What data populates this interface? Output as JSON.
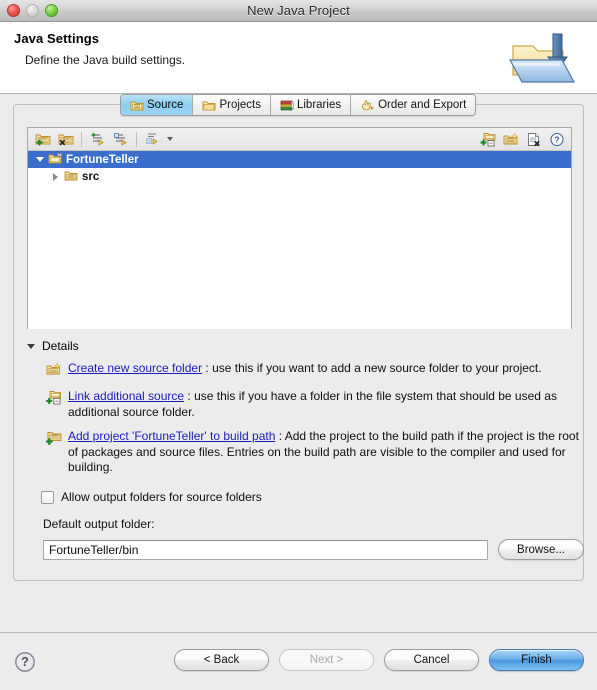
{
  "window": {
    "title": "New Java Project",
    "controls": {
      "close": "close-button",
      "minimize": "minimize-button",
      "zoom": "zoom-button"
    }
  },
  "header": {
    "title": "Java Settings",
    "subtitle": "Define the Java build settings.",
    "icon": "java-project-folder-icon"
  },
  "tabs": [
    {
      "label": "Source",
      "icon": "source-folder-icon",
      "active": true
    },
    {
      "label": "Projects",
      "icon": "projects-folder-icon",
      "active": false
    },
    {
      "label": "Libraries",
      "icon": "libraries-books-icon",
      "active": false
    },
    {
      "label": "Order and Export",
      "icon": "order-export-hand-icon",
      "active": false
    }
  ],
  "tree_toolbar": {
    "left": [
      {
        "name": "add-source-folder-icon",
        "tooltip": "Add Folder"
      },
      {
        "name": "remove-source-folder-icon",
        "tooltip": "Remove Folder"
      },
      {
        "name": "add-inclusion-filter-icon",
        "tooltip": "Add Inclusion"
      },
      {
        "name": "add-exclusion-filter-icon",
        "tooltip": "Add Exclusion"
      },
      {
        "name": "configure-filters-icon",
        "tooltip": "Configure"
      }
    ],
    "right": [
      {
        "name": "link-source-icon",
        "tooltip": "Link Source"
      },
      {
        "name": "create-folder-icon",
        "tooltip": "Create New Folder"
      },
      {
        "name": "remove-entry-icon",
        "tooltip": "Remove"
      },
      {
        "name": "help-circle-icon",
        "tooltip": "Help"
      }
    ]
  },
  "tree": [
    {
      "label": "FortuneTeller",
      "icon": "java-project-icon",
      "selected": true,
      "expanded": true,
      "depth": 0
    },
    {
      "label": "src",
      "icon": "source-folder-icon",
      "selected": false,
      "expanded": false,
      "depth": 1
    }
  ],
  "details": {
    "header": "Details",
    "expanded": true,
    "items": [
      {
        "icon": "create-source-folder-icon",
        "link": "Create new source folder",
        "text": " : use this if you want to add a new source folder to your project."
      },
      {
        "icon": "link-additional-source-icon",
        "link": "Link additional source",
        "text": " : use this if you have a folder in the file system that should be used as additional source folder."
      },
      {
        "icon": "add-project-to-build-path-icon",
        "link": "Add project 'FortuneTeller' to build path",
        "text": " : Add the project to the build path if the project is the root of packages and source files. Entries on the build path are visible to the compiler and used for building."
      }
    ]
  },
  "allow_output_folders": {
    "label": "Allow output folders for source folders",
    "checked": false
  },
  "default_output_folder": {
    "label": "Default output folder:",
    "value": "FortuneTeller/bin",
    "placeholder": "",
    "browse_label": "Browse..."
  },
  "footer": {
    "help_icon": "help-circle-icon",
    "buttons": [
      {
        "label": "< Back",
        "state": "enabled",
        "name": "back-button"
      },
      {
        "label": "Next >",
        "state": "disabled",
        "name": "next-button"
      },
      {
        "label": "Cancel",
        "state": "enabled",
        "name": "cancel-button"
      },
      {
        "label": "Finish",
        "state": "default",
        "name": "finish-button"
      }
    ]
  },
  "colors": {
    "selection_blue": "#3b6ecc",
    "active_tab_blue": "#8ecdf0",
    "link_blue": "#1b1bbb",
    "window_bg": "#ececec",
    "primary_button": "#69aeea"
  }
}
